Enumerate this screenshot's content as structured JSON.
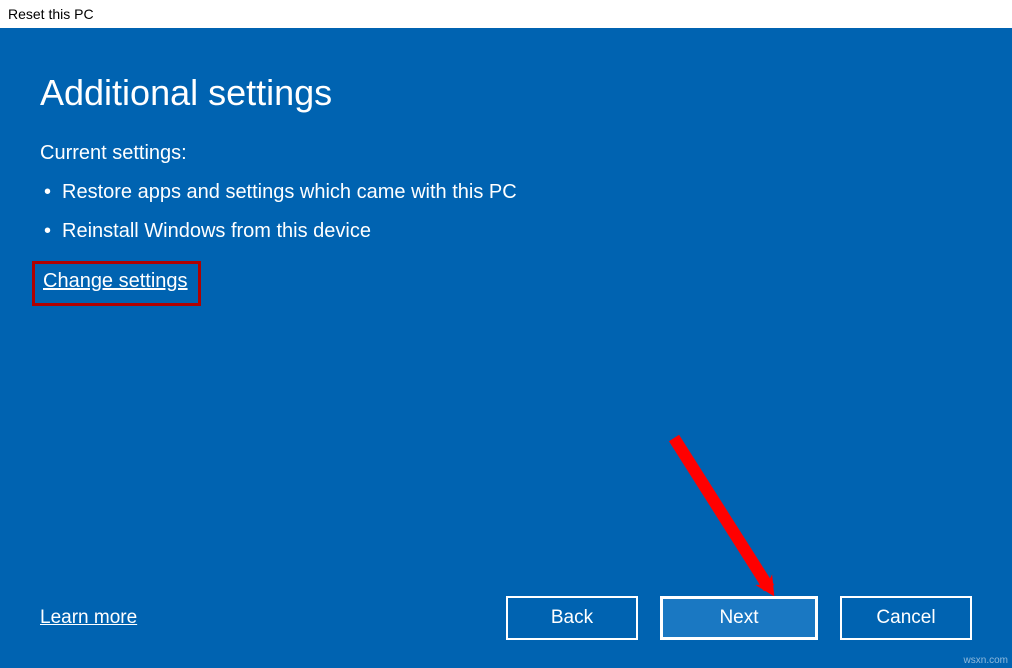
{
  "window": {
    "title": "Reset this PC"
  },
  "wizard": {
    "heading": "Additional settings",
    "current_label": "Current settings:",
    "items": [
      "Restore apps and settings which came with this PC",
      "Reinstall Windows from this device"
    ],
    "change_link": "Change settings"
  },
  "footer": {
    "learn_more": "Learn more",
    "buttons": {
      "back": "Back",
      "next": "Next",
      "cancel": "Cancel"
    }
  },
  "annotation": {
    "arrow_color": "#ff0000",
    "highlight_color": "#b00000"
  },
  "watermark": "wsxn.com"
}
